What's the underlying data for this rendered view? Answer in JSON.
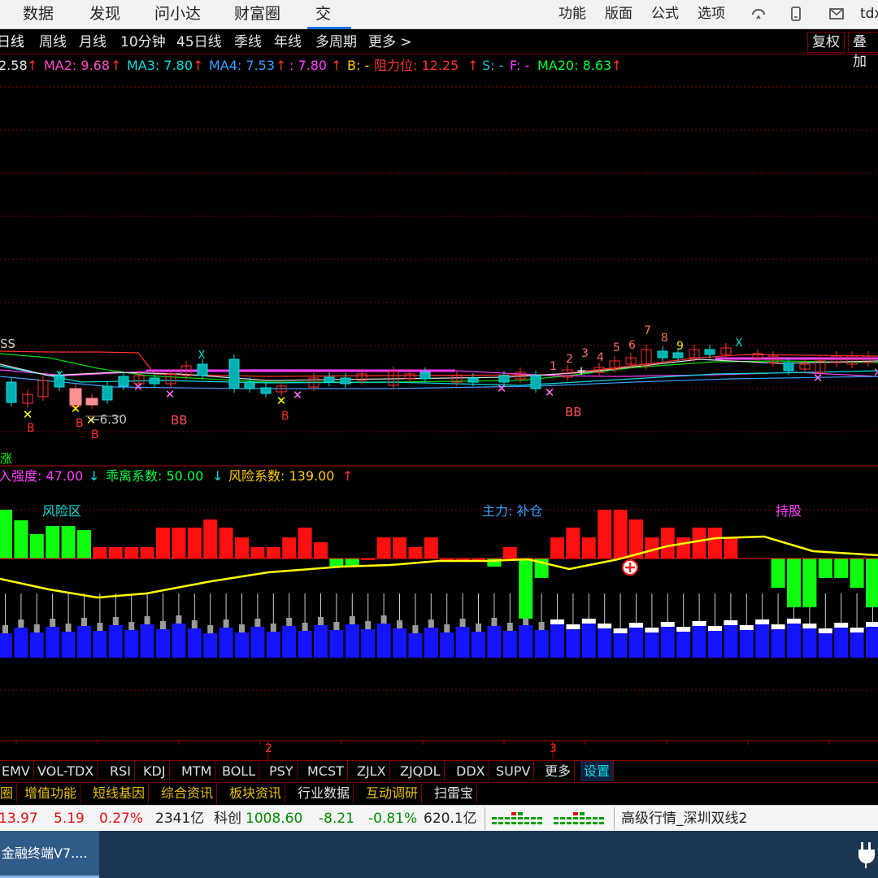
{
  "topmenu": {
    "items": [
      "数据",
      "发现",
      "问小达",
      "财富圈",
      "交易"
    ],
    "right": [
      "功能",
      "版面",
      "公式",
      "选项"
    ],
    "tdx": "tdx"
  },
  "periods": {
    "items": [
      "日线",
      "周线",
      "月线",
      "10分钟",
      "45日线",
      "季线",
      "年线",
      "多周期",
      "更多 >"
    ],
    "buttons": [
      "复权",
      "叠加"
    ]
  },
  "ma_legend": {
    "ma1": "2.58",
    "ma2": "MA2: 9.68",
    "ma3": "MA3: 7.80",
    "ma4": "MA4: 7.53",
    "ma5": ": 7.80",
    "b": "B: -",
    "resist": "阻力位: 12.25",
    "s": "S: -",
    "f": "F: -",
    "ma20": "MA20: 8.63",
    "up_arrow": "↑"
  },
  "kline_labels": {
    "ss": "SS",
    "arrow_label": "←6.30",
    "bb1": "BB",
    "bb2": "BB",
    "b_marks": [
      "B",
      "B",
      "B",
      "B"
    ],
    "counts": [
      "1",
      "2",
      "3",
      "4",
      "5",
      "6",
      "7",
      "8",
      "9"
    ]
  },
  "sub_legend": {
    "prefix": "入强度: 47.00",
    "down": "↓",
    "deviation": "乖离系数: 50.00",
    "risk": "风险系数: 139.00",
    "up": "↑",
    "left_char": "涨"
  },
  "sub_labels": {
    "risk_zone": "风险区",
    "main_force": "主力: 补仓",
    "hold": "持股"
  },
  "axis_marks": [
    "2",
    "3"
  ],
  "indicator_tabs": [
    "EMV",
    "VOL-TDX",
    "RSI",
    "KDJ",
    "MTM",
    "BOLL",
    "PSY",
    "MCST",
    "ZJLX",
    "ZJQDL",
    "DDX",
    "SUPV",
    "更多",
    "设置"
  ],
  "function_tabs": [
    "圈",
    "增值功能",
    "短线基因",
    "综合资讯",
    "板块资讯",
    "行业数据",
    "互动调研",
    "扫雷宝"
  ],
  "status": {
    "v1": "13.97",
    "v2": "5.19",
    "v3": "0.27%",
    "v4": "2341亿",
    "kc_name": "科创",
    "kc_val": "1008.60",
    "kc_chg": "-8.21",
    "kc_pct": "-0.81%",
    "kc_amt": "620.1亿",
    "feed": "高级行情_深圳双线2"
  },
  "taskbar": {
    "app": "金融终端V7...."
  },
  "colors": {
    "up": "#ff3030",
    "down": "#00e0e0",
    "yellow": "#ffff00",
    "green": "#00ff00",
    "magenta": "#ff40ff",
    "blue": "#1010ff"
  }
}
